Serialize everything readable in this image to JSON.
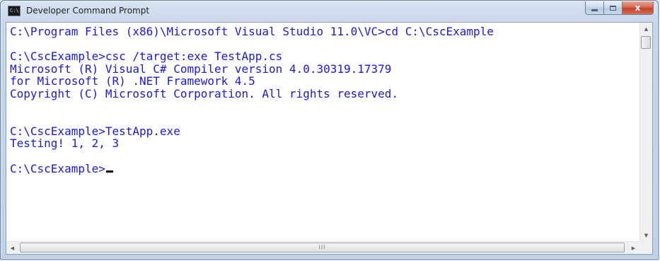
{
  "window": {
    "title": "Developer Command Prompt",
    "icon": "console-icon",
    "icon_glyph": "C:\\"
  },
  "caption": {
    "minimize_icon": "minimize-icon",
    "maximize_icon": "maximize-icon",
    "close_icon": "close-icon",
    "close_glyph": "x"
  },
  "console": {
    "lines": [
      "C:\\Program Files (x86)\\Microsoft Visual Studio 11.0\\VC>cd C:\\CscExample",
      "",
      "C:\\CscExample>csc /target:exe TestApp.cs",
      "Microsoft (R) Visual C# Compiler version 4.0.30319.17379",
      "for Microsoft (R) .NET Framework 4.5",
      "Copyright (C) Microsoft Corporation. All rights reserved.",
      "",
      "",
      "C:\\CscExample>TestApp.exe",
      "Testing! 1, 2, 3",
      "",
      "C:\\CscExample>"
    ],
    "text_color": "#1a1ad2",
    "background_color": "#ffffff"
  },
  "scrollbars": {
    "up_glyph": "▲",
    "down_glyph": "▼",
    "left_glyph": "◀",
    "right_glyph": "▶",
    "grip_glyph": "III"
  }
}
